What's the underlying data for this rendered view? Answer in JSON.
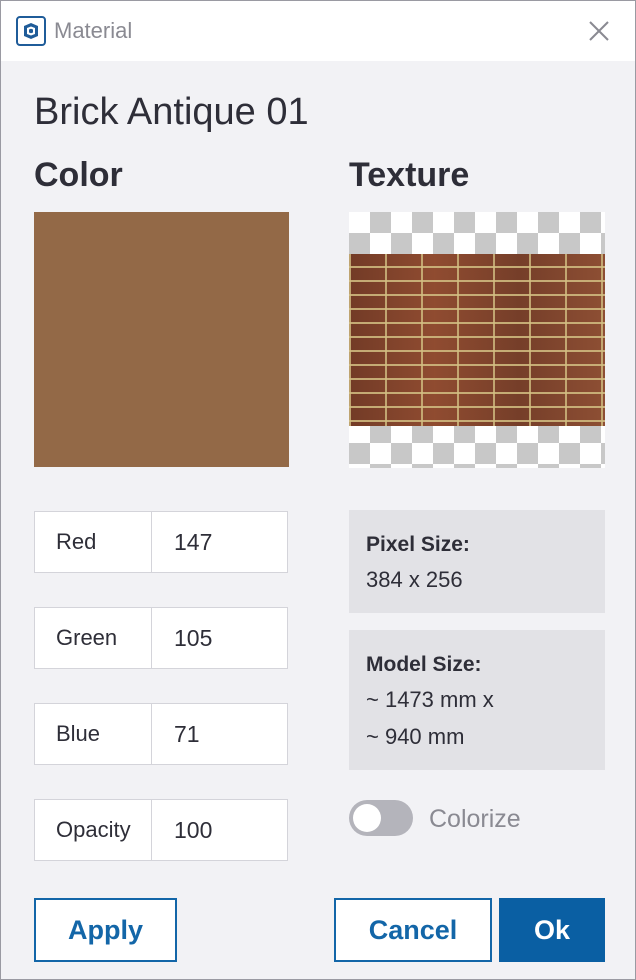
{
  "window": {
    "title": "Material",
    "app_icon": "sketchup-logo-icon",
    "close_icon": "close-icon"
  },
  "material": {
    "name": "Brick Antique 01"
  },
  "color": {
    "heading": "Color",
    "swatch_hex": "#936947",
    "fields": [
      {
        "label": "Red",
        "value": "147"
      },
      {
        "label": "Green",
        "value": "105"
      },
      {
        "label": "Blue",
        "value": "71"
      },
      {
        "label": "Opacity",
        "value": "100"
      }
    ]
  },
  "texture": {
    "heading": "Texture",
    "pixel_size_label": "Pixel Size:",
    "pixel_size_value": "384 x 256",
    "model_size_label": "Model Size:",
    "model_size_line1": "~ 1473 mm x",
    "model_size_line2": "~ 940 mm",
    "colorize_label": "Colorize",
    "colorize_on": false
  },
  "buttons": {
    "apply": "Apply",
    "cancel": "Cancel",
    "ok": "Ok"
  },
  "colors": {
    "accent": "#0a5fa3",
    "background": "#f2f2f5",
    "info_box": "#e2e2e6"
  }
}
